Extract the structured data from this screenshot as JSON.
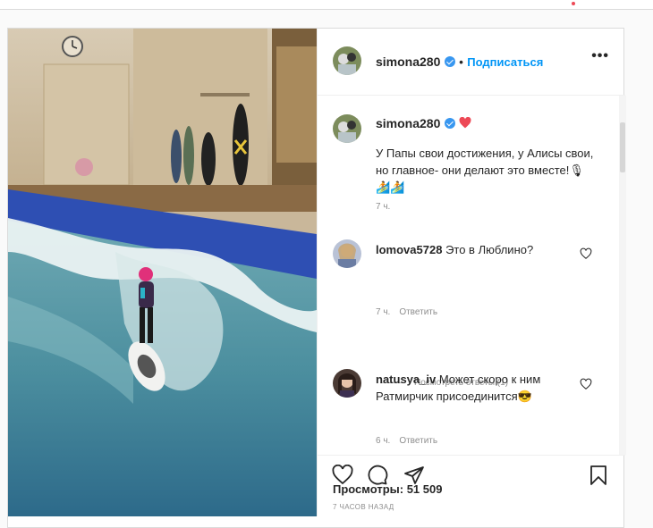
{
  "author": {
    "username": "simona280",
    "follow_label": "Подписаться",
    "separator": "•",
    "more_label": "•••"
  },
  "caption": {
    "username": "simona280",
    "text": "У Папы свои достижения, у Алисы свои, но главное- они делают это вместе!",
    "emoji": "🎙🏄🏄",
    "time": "7 ч."
  },
  "comments": [
    {
      "username": "lomova5728",
      "text": "Это в Люблино?",
      "time": "7 ч.",
      "reply_label": "Ответить"
    },
    {
      "username": "natusya_iv",
      "text": "Может скоро к ним Ратмирчик присоединится😎",
      "time": "6 ч.",
      "reply_label": "Ответить"
    }
  ],
  "view_replies": "Посмотреть ответы (1)",
  "views": "Просмотры: 51 509",
  "posted_ago": "7 ЧАСОВ НАЗАД",
  "icons": {
    "verified": "verified-badge-icon",
    "heart": "heart-icon",
    "comment": "comment-icon",
    "share": "share-icon",
    "save": "bookmark-icon"
  },
  "colors": {
    "accent": "#0095f6",
    "verified": "#3897f0",
    "heart_red": "#ed4956",
    "text": "#262626",
    "muted": "#8e8e8e"
  }
}
